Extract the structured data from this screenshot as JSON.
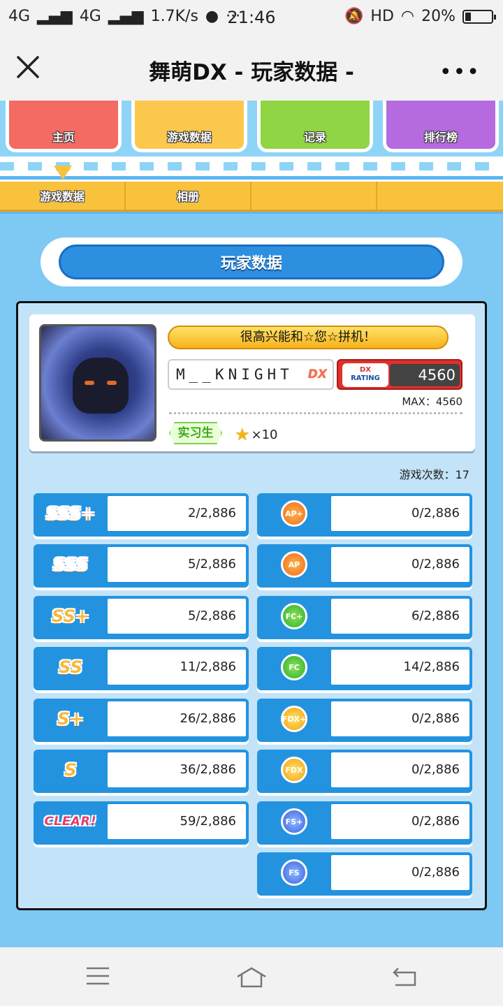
{
  "status_bar": {
    "network_1": "4G",
    "network_2": "4G",
    "speed": "1.7K/s",
    "time": "21:46",
    "hd": "HD",
    "battery": "20%",
    "battery_level": 0.2
  },
  "title_bar": {
    "title": "舞萌DX - 玩家数据 -"
  },
  "top_nav": {
    "items": [
      {
        "label": "主页",
        "color": "#f36b63"
      },
      {
        "label": "游戏数据",
        "color": "#fbc84d"
      },
      {
        "label": "记录",
        "color": "#8fd544"
      },
      {
        "label": "排行榜",
        "color": "#b56ae0"
      }
    ]
  },
  "tabs": {
    "items": [
      {
        "label": "游戏数据",
        "selected": true
      },
      {
        "label": "相册"
      },
      {
        "label": ""
      },
      {
        "label": ""
      }
    ]
  },
  "section": {
    "title": "玩家数据"
  },
  "profile": {
    "greeting": "很高兴能和☆您☆拼机！",
    "name": "M__KNIGHT",
    "dx_tag": "DX",
    "rating_label_1": "DX",
    "rating_label_2": "RATING",
    "rating": "4560",
    "max": "MAX：4560",
    "class": "实习生",
    "stars": "×10"
  },
  "play_count": "游戏次数：17",
  "ranks": [
    {
      "label": "SSS+",
      "value": "2/2,886"
    },
    {
      "label": "SSS",
      "value": "5/2,886"
    },
    {
      "label": "SS+",
      "value": "5/2,886"
    },
    {
      "label": "SS",
      "value": "11/2,886"
    },
    {
      "label": "S+",
      "value": "26/2,886"
    },
    {
      "label": "S",
      "value": "36/2,886"
    },
    {
      "label": "CLEAR!",
      "value": "59/2,886"
    }
  ],
  "achievements": [
    {
      "label": "AP+",
      "value": "0/2,886",
      "medal": "ap"
    },
    {
      "label": "AP",
      "value": "0/2,886",
      "medal": "ap"
    },
    {
      "label": "FC+",
      "value": "6/2,886",
      "medal": "fc"
    },
    {
      "label": "FC",
      "value": "14/2,886",
      "medal": "fc"
    },
    {
      "label": "FDX+",
      "value": "0/2,886",
      "medal": "fdx"
    },
    {
      "label": "FDX",
      "value": "0/2,886",
      "medal": "fdx"
    },
    {
      "label": "FS+",
      "value": "0/2,886",
      "medal": "fs"
    },
    {
      "label": "FS",
      "value": "0/2,886",
      "medal": "fs"
    }
  ],
  "colors": {
    "sky": "#5ab8f0",
    "panel": "#c3e3f8",
    "tile_blue": "#2393e0",
    "tab_yellow": "#f9c23c",
    "rating_red": "#e0302c"
  }
}
